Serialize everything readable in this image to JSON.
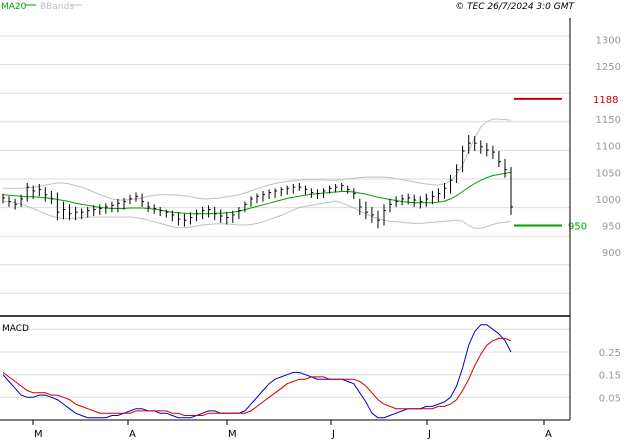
{
  "header": {
    "ma_label": "MA20",
    "bb_label": "BBands",
    "copyright": "© TEC 26/7/2024 3:0 GMT"
  },
  "colors": {
    "ma": "#00a000",
    "bands": "#c0c0c0",
    "price": "#000000",
    "macd": "#0000cc",
    "signal": "#cc0000",
    "resistance": "#cc0000",
    "support": "#00a000",
    "grid": "#dddddd"
  },
  "chart_data": [
    {
      "type": "line",
      "title": "",
      "ylim": [
        780,
        1340
      ],
      "y_ticks": [
        900,
        950,
        1000,
        1050,
        1100,
        1150,
        1250,
        1300
      ],
      "months": [
        "M",
        "A",
        "M",
        "J",
        "J",
        "A"
      ],
      "price_bars": [
        [
          1010,
          992,
          1002
        ],
        [
          1005,
          985,
          995
        ],
        [
          1000,
          980,
          990
        ],
        [
          1008,
          985,
          1000
        ],
        [
          1030,
          995,
          1022
        ],
        [
          1025,
          1000,
          1015
        ],
        [
          1028,
          1005,
          1018
        ],
        [
          1022,
          995,
          1008
        ],
        [
          1015,
          990,
          1000
        ],
        [
          1012,
          960,
          975
        ],
        [
          995,
          962,
          980
        ],
        [
          990,
          960,
          972
        ],
        [
          985,
          960,
          975
        ],
        [
          982,
          962,
          975
        ],
        [
          985,
          965,
          978
        ],
        [
          988,
          968,
          980
        ],
        [
          990,
          970,
          982
        ],
        [
          992,
          972,
          985
        ],
        [
          995,
          975,
          988
        ],
        [
          1000,
          975,
          992
        ],
        [
          1002,
          980,
          995
        ],
        [
          1008,
          990,
          1000
        ],
        [
          1012,
          995,
          1005
        ],
        [
          1010,
          985,
          995
        ],
        [
          995,
          975,
          985
        ],
        [
          990,
          972,
          982
        ],
        [
          985,
          968,
          978
        ],
        [
          980,
          965,
          975
        ],
        [
          978,
          958,
          970
        ],
        [
          975,
          950,
          962
        ],
        [
          972,
          948,
          960
        ],
        [
          975,
          952,
          965
        ],
        [
          980,
          958,
          972
        ],
        [
          985,
          962,
          978
        ],
        [
          988,
          965,
          980
        ],
        [
          985,
          960,
          972
        ],
        [
          980,
          955,
          968
        ],
        [
          975,
          952,
          965
        ],
        [
          978,
          955,
          970
        ],
        [
          985,
          962,
          978
        ],
        [
          995,
          975,
          990
        ],
        [
          1005,
          985,
          1000
        ],
        [
          1010,
          992,
          1005
        ],
        [
          1015,
          995,
          1008
        ],
        [
          1018,
          1000,
          1012
        ],
        [
          1020,
          1002,
          1015
        ],
        [
          1022,
          1005,
          1018
        ],
        [
          1025,
          1008,
          1020
        ],
        [
          1028,
          1010,
          1022
        ],
        [
          1030,
          1015,
          1022
        ],
        [
          1025,
          1008,
          1018
        ],
        [
          1020,
          1002,
          1012
        ],
        [
          1018,
          1000,
          1010
        ],
        [
          1020,
          1002,
          1015
        ],
        [
          1025,
          1010,
          1020
        ],
        [
          1028,
          1012,
          1022
        ],
        [
          1030,
          1015,
          1025
        ],
        [
          1025,
          1010,
          1018
        ],
        [
          1020,
          1000,
          1010
        ],
        [
          1000,
          970,
          985
        ],
        [
          995,
          962,
          975
        ],
        [
          985,
          955,
          970
        ],
        [
          978,
          945,
          960
        ],
        [
          990,
          950,
          978
        ],
        [
          1000,
          975,
          990
        ],
        [
          1005,
          985,
          995
        ],
        [
          1008,
          988,
          1000
        ],
        [
          1010,
          990,
          1002
        ],
        [
          1008,
          985,
          998
        ],
        [
          1005,
          982,
          995
        ],
        [
          1010,
          985,
          1000
        ],
        [
          1015,
          990,
          1005
        ],
        [
          1020,
          995,
          1010
        ],
        [
          1030,
          1000,
          1020
        ],
        [
          1045,
          1010,
          1035
        ],
        [
          1065,
          1030,
          1055
        ],
        [
          1100,
          1050,
          1090
        ],
        [
          1120,
          1085,
          1105
        ],
        [
          1118,
          1090,
          1105
        ],
        [
          1110,
          1085,
          1098
        ],
        [
          1105,
          1080,
          1092
        ],
        [
          1100,
          1075,
          1088
        ],
        [
          1090,
          1060,
          1070
        ],
        [
          1075,
          1040,
          1055
        ],
        [
          1060,
          970,
          985
        ]
      ],
      "ma20": [
        1008,
        1007,
        1006,
        1005,
        1004,
        1004,
        1003,
        1002,
        1001,
        999,
        997,
        995,
        992,
        990,
        988,
        986,
        984,
        983,
        982,
        982,
        982,
        983,
        983,
        983,
        982,
        981,
        979,
        977,
        975,
        974,
        973,
        972,
        972,
        972,
        972,
        973,
        973,
        974,
        975,
        977,
        980,
        983,
        986,
        989,
        992,
        995,
        998,
        1001,
        1003,
        1005,
        1007,
        1009,
        1010,
        1011,
        1012,
        1013,
        1014,
        1014,
        1013,
        1011,
        1009,
        1006,
        1003,
        1001,
        999,
        997,
        995,
        994,
        993,
        993,
        993,
        993,
        994,
        996,
        1000,
        1006,
        1014,
        1022,
        1029,
        1035,
        1040,
        1044,
        1046,
        1048,
        1050
      ],
      "bb_upper": [
        1020,
        1020,
        1020,
        1020,
        1021,
        1022,
        1024,
        1026,
        1028,
        1030,
        1030,
        1028,
        1025,
        1022,
        1018,
        1013,
        1008,
        1004,
        1000,
        998,
        998,
        999,
        1000,
        1002,
        1005,
        1007,
        1008,
        1008,
        1008,
        1007,
        1006,
        1004,
        1002,
        1000,
        1000,
        1001,
        1002,
        1004,
        1006,
        1008,
        1011,
        1015,
        1019,
        1023,
        1026,
        1029,
        1031,
        1033,
        1034,
        1035,
        1036,
        1036,
        1036,
        1036,
        1035,
        1035,
        1036,
        1038,
        1039,
        1040,
        1041,
        1041,
        1041,
        1041,
        1040,
        1038,
        1036,
        1034,
        1032,
        1030,
        1028,
        1027,
        1026,
        1028,
        1034,
        1046,
        1064,
        1090,
        1115,
        1135,
        1145,
        1150,
        1150,
        1149,
        1148
      ],
      "bb_lower": [
        996,
        995,
        993,
        990,
        986,
        982,
        977,
        972,
        968,
        965,
        963,
        963,
        964,
        965,
        966,
        966,
        966,
        966,
        966,
        966,
        966,
        966,
        965,
        963,
        960,
        957,
        954,
        951,
        948,
        946,
        946,
        947,
        949,
        951,
        952,
        953,
        953,
        953,
        952,
        951,
        951,
        952,
        954,
        957,
        961,
        965,
        969,
        974,
        979,
        984,
        986,
        988,
        990,
        992,
        994,
        996,
        993,
        988,
        983,
        977,
        972,
        967,
        963,
        960,
        958,
        957,
        956,
        955,
        954,
        954,
        955,
        956,
        957,
        958,
        959,
        960,
        958,
        950,
        945,
        945,
        948,
        952,
        955,
        956,
        958
      ],
      "levels": [
        {
          "label": "1188",
          "value": 1188
        },
        {
          "label": "950",
          "value": 950
        }
      ]
    },
    {
      "type": "line",
      "title": "MACD",
      "ylim": [
        -5,
        40
      ],
      "y_ticks": [
        5,
        15,
        25
      ],
      "series": [
        {
          "values": [
            15,
            12,
            9,
            6,
            5,
            5,
            6,
            6,
            5,
            4,
            2,
            0,
            -2,
            -3,
            -4,
            -4,
            -4,
            -4,
            -3,
            -3,
            -2,
            -1,
            0,
            0,
            -1,
            -1,
            -2,
            -2,
            -3,
            -4,
            -4,
            -4,
            -3,
            -2,
            -1,
            -1,
            -2,
            -2,
            -2,
            -2,
            -1,
            2,
            5,
            8,
            11,
            13,
            14,
            15,
            16,
            16,
            15,
            14,
            13,
            13,
            13,
            13,
            13,
            12,
            11,
            7,
            3,
            -2,
            -4,
            -4,
            -3,
            -2,
            -1,
            0,
            0,
            0,
            1,
            1,
            2,
            3,
            5,
            10,
            18,
            28,
            34,
            37,
            37,
            35,
            33,
            30,
            25
          ]
        },
        {
          "values": [
            16,
            14,
            12,
            10,
            8,
            7,
            7,
            7,
            6,
            6,
            5,
            4,
            2,
            1,
            0,
            -1,
            -2,
            -2,
            -2,
            -2,
            -2,
            -2,
            -1,
            -1,
            -1,
            -1,
            -1,
            -1,
            -2,
            -2,
            -3,
            -3,
            -3,
            -3,
            -2,
            -2,
            -2,
            -2,
            -2,
            -2,
            -2,
            -1,
            1,
            3,
            5,
            7,
            9,
            11,
            12,
            13,
            13,
            14,
            14,
            14,
            13,
            13,
            13,
            13,
            13,
            12,
            10,
            7,
            4,
            2,
            1,
            0,
            0,
            0,
            0,
            0,
            0,
            0,
            1,
            1,
            2,
            4,
            8,
            13,
            19,
            24,
            28,
            30,
            31,
            31,
            30
          ]
        }
      ]
    }
  ]
}
